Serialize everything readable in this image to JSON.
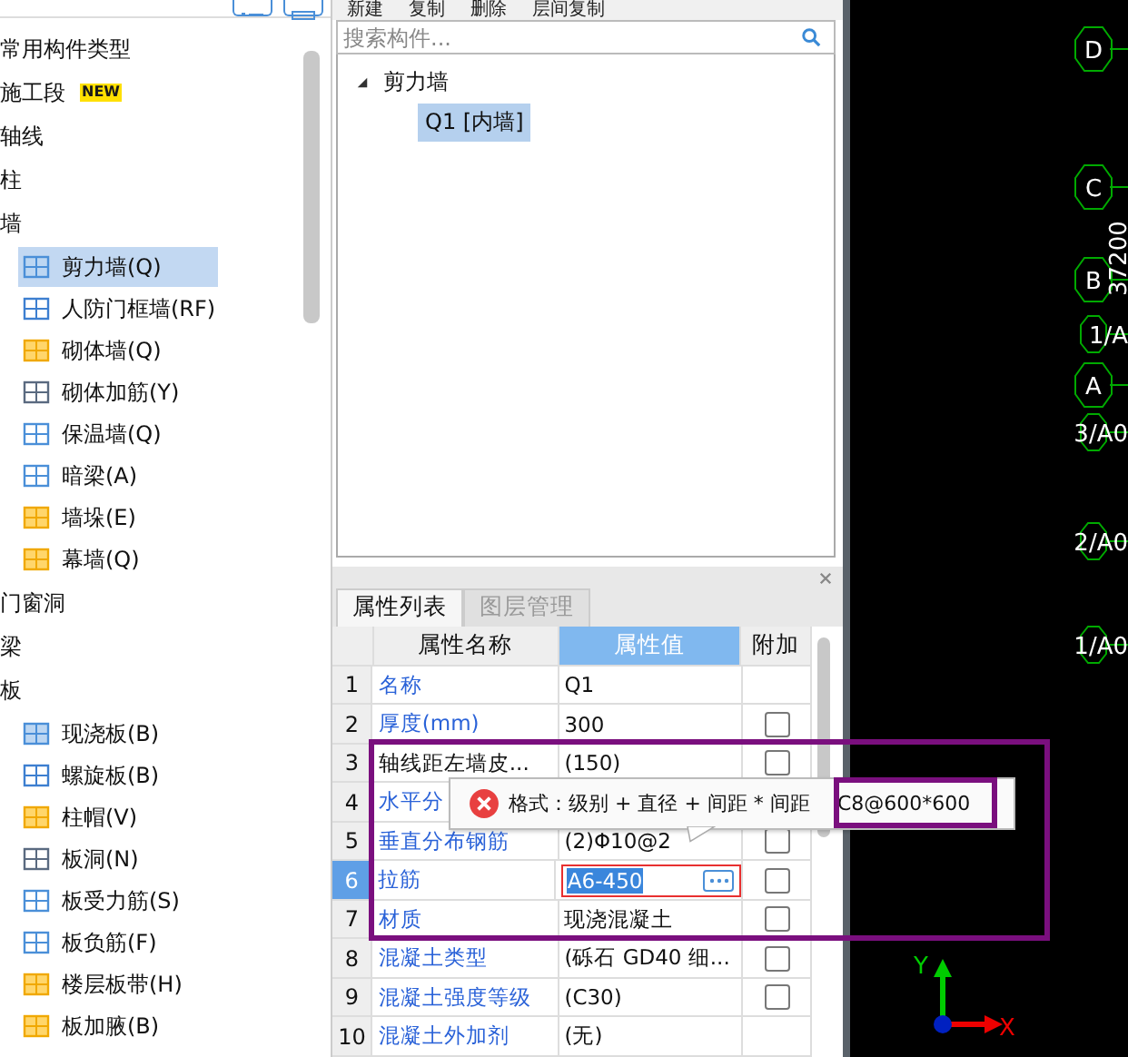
{
  "left_toolbar": {
    "buttons": [
      {
        "kind": "list"
      },
      {
        "kind": "panel"
      }
    ]
  },
  "component_tree": [
    {
      "label": "常用构件类型"
    },
    {
      "label": "施工段",
      "badge": "NEW"
    },
    {
      "label": "轴线"
    },
    {
      "label": "柱"
    },
    {
      "label": "墙",
      "children": [
        {
          "label": "剪力墙(Q)",
          "selected": true
        },
        {
          "label": "人防门框墙(RF)",
          "selected": false
        },
        {
          "label": "砌体墙(Q)",
          "selected": false
        },
        {
          "label": "砌体加筋(Y)",
          "selected": false
        },
        {
          "label": "保温墙(Q)",
          "selected": false
        },
        {
          "label": "暗梁(A)",
          "selected": false
        },
        {
          "label": "墙垛(E)",
          "selected": false
        },
        {
          "label": "幕墙(Q)",
          "selected": false
        }
      ]
    },
    {
      "label": "门窗洞"
    },
    {
      "label": "梁"
    },
    {
      "label": "板",
      "children": [
        {
          "label": "现浇板(B)",
          "selected": false
        },
        {
          "label": "螺旋板(B)",
          "selected": false
        },
        {
          "label": "柱帽(V)",
          "selected": false
        },
        {
          "label": "板洞(N)",
          "selected": false
        },
        {
          "label": "板受力筋(S)",
          "selected": false
        },
        {
          "label": "板负筋(F)",
          "selected": false
        },
        {
          "label": "楼层板带(H)",
          "selected": false
        },
        {
          "label": "板加腋(B)",
          "selected": false
        }
      ]
    }
  ],
  "toolbar": [
    "新建",
    "复制",
    "删除",
    "层间复制"
  ],
  "search": {
    "placeholder": "搜索构件..."
  },
  "instance_tree": [
    {
      "label": "剪力墙",
      "expanded": true,
      "children": [
        {
          "label": "Q1 [内墙]",
          "selected": true
        }
      ]
    }
  ],
  "property_panel": {
    "tabs": [
      {
        "label": "属性列表",
        "selected": true
      },
      {
        "label": "图层管理",
        "selected": false
      }
    ],
    "columns": [
      {
        "label": "属性名称",
        "selected": false
      },
      {
        "label": "属性值",
        "selected": true
      },
      {
        "label": "附加",
        "selected": false
      }
    ],
    "rows": [
      {
        "index": "1",
        "name": "名称",
        "public": true,
        "value": "Q1",
        "selected": false
      },
      {
        "index": "2",
        "name": "厚度(mm)",
        "public": true,
        "value": "300",
        "selected": false,
        "checked": false
      },
      {
        "index": "3",
        "name": "轴线距左墙皮...",
        "public": false,
        "value": "(150)",
        "selected": false,
        "checked": false
      },
      {
        "index": "4",
        "name": "水平分",
        "public": true,
        "selected": false
      },
      {
        "index": "5",
        "name": "垂直分布钢筋",
        "public": true,
        "value": "(2)Φ10@2",
        "selected": false,
        "checked": false
      },
      {
        "index": "6",
        "name": "拉筋",
        "public": true,
        "value": "A6-450",
        "selected": true,
        "editing": true,
        "checked": false
      },
      {
        "index": "7",
        "name": "材质",
        "public": true,
        "value": "现浇混凝土",
        "selected": false,
        "checked": false
      },
      {
        "index": "8",
        "name": "混凝土类型",
        "public": true,
        "value": "(砾石 GD40 细...",
        "selected": false,
        "checked": false
      },
      {
        "index": "9",
        "name": "混凝土强度等级",
        "public": true,
        "value": "(C30)",
        "selected": false,
        "checked": false
      },
      {
        "index": "10",
        "name": "混凝土外加剂",
        "public": true,
        "value": "(无)",
        "selected": false
      }
    ]
  },
  "error_tooltip": {
    "message": "格式：级别 + 直径 + 间距 * 间距",
    "example": "C8@600*600"
  },
  "canvas": {
    "grid_axes": [
      "D",
      "C",
      "B",
      "A"
    ],
    "sub_axes": [
      "1/A",
      "3/A0",
      "2/A0",
      "1/A0"
    ],
    "dimension": "37200",
    "axis_labels": {
      "y": "Y",
      "x": "X"
    }
  }
}
